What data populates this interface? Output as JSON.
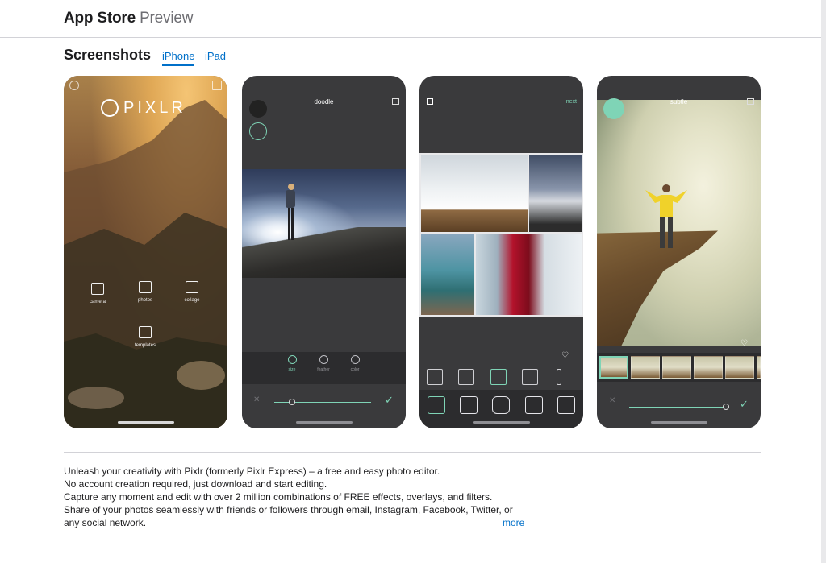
{
  "header": {
    "brand": "App Store",
    "brand_sub": "Preview"
  },
  "screenshots": {
    "title": "Screenshots",
    "tabs": [
      {
        "label": "iPhone",
        "active": true
      },
      {
        "label": "iPad",
        "active": false
      }
    ]
  },
  "phones": {
    "p1": {
      "logo": "PIXLR",
      "menu": [
        "camera",
        "photos",
        "collage",
        "templates"
      ]
    },
    "p2": {
      "title": "doodle",
      "tools": [
        "size",
        "feather",
        "color"
      ]
    },
    "p3": {
      "next": "next"
    },
    "p4": {
      "title": "subtle"
    }
  },
  "description": {
    "lines": [
      "Unleash your creativity with Pixlr (formerly Pixlr Express) – a free and easy photo editor.",
      "No account creation required, just download and start editing.",
      "Capture any moment and edit with over 2 million combinations of FREE effects, overlays, and filters.",
      "Share of your photos seamlessly with friends or followers through email, Instagram, Facebook, Twitter, or",
      "any social network."
    ],
    "more": "more"
  },
  "colors": {
    "accent": "#0070c9",
    "mint": "#7fd4b6",
    "dark_ui": "#3a3a3c"
  }
}
